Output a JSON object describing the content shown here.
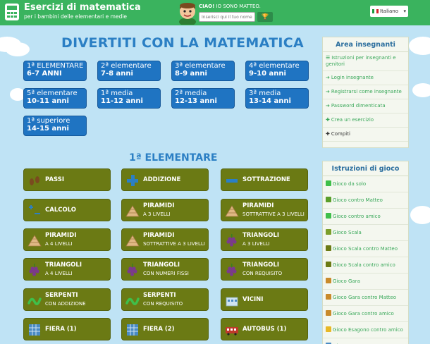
{
  "header": {
    "title": "Esercizi di matematica",
    "subtitle": "per i bambini delle elementari e medie",
    "mascot_greeting_bold": "CIAO!",
    "mascot_greeting": " IO SONO MATTEO.",
    "mascot_placeholder": "Inserisci qui il tuo nome",
    "language": "Italiano"
  },
  "main": {
    "title": "DIVERTITI CON LA MATEMATICA",
    "levels": [
      {
        "line1": "1ª ELEMENTARE",
        "line2": "6-7 ANNI"
      },
      {
        "line1": "2ª elementare",
        "line2": "7-8 anni"
      },
      {
        "line1": "3ª elementare",
        "line2": "8-9 anni"
      },
      {
        "line1": "4ª elementare",
        "line2": "9-10 anni"
      },
      {
        "line1": "5ª elementare",
        "line2": "10-11 anni"
      },
      {
        "line1": "1ª media",
        "line2": "11-12 anni"
      },
      {
        "line1": "2ª media",
        "line2": "12-13 anni"
      },
      {
        "line1": "3ª media",
        "line2": "13-14 anni"
      },
      {
        "line1": "1ª superiore",
        "line2": "14-15 anni"
      }
    ],
    "section_title": "1ª ELEMENTARE",
    "games": [
      {
        "name": "PASSI",
        "sub": ""
      },
      {
        "name": "ADDIZIONE",
        "sub": ""
      },
      {
        "name": "SOTTRAZIONE",
        "sub": ""
      },
      {
        "name": "CALCOLO",
        "sub": ""
      },
      {
        "name": "PIRAMIDI",
        "sub": "A 3 LIVELLI"
      },
      {
        "name": "PIRAMIDI",
        "sub": "SOTTRATTIVE A 3 LIVELLI"
      },
      {
        "name": "PIRAMIDI",
        "sub": "A 4 LIVELLI"
      },
      {
        "name": "PIRAMIDI",
        "sub": "SOTTRATTIVE A 3 LIVELLI"
      },
      {
        "name": "TRIANGOLI",
        "sub": "A 3 LIVELLI"
      },
      {
        "name": "TRIANGOLI",
        "sub": "A 4 LIVELLI"
      },
      {
        "name": "TRIANGOLI",
        "sub": "CON NUMERI FISSI"
      },
      {
        "name": "TRIANGOLI",
        "sub": "CON REQUISITO"
      },
      {
        "name": "SERPENTI",
        "sub": "CON ADDIZIONE"
      },
      {
        "name": "SERPENTI",
        "sub": "CON REQUISITO"
      },
      {
        "name": "VICINI",
        "sub": ""
      },
      {
        "name": "FIERA (1)",
        "sub": ""
      },
      {
        "name": "FIERA (2)",
        "sub": ""
      },
      {
        "name": "AUTOBUS (1)",
        "sub": ""
      }
    ]
  },
  "sidebar": {
    "teachers_title": "Area insegnanti",
    "teachers": [
      "Istruzioni per insegnanti e genitori",
      "Login insegnante",
      "Registrarsi come insegnante",
      "Password dimenticata",
      "Crea un esercizio",
      "Compiti"
    ],
    "games_title": "Istruzioni di gioco",
    "game_instr": [
      "Gioco da solo",
      "Gioco contro Matteo",
      "Gioco contro amico",
      "Gioco Scala",
      "Gioco Scala contro Matteo",
      "Gioco Scala contro amico",
      "Gioco Gara",
      "Gioco Gara contro Matteo",
      "Gioco Gara contro amico",
      "Gioco Esagono contro amico",
      "Gioco Mappa"
    ]
  }
}
